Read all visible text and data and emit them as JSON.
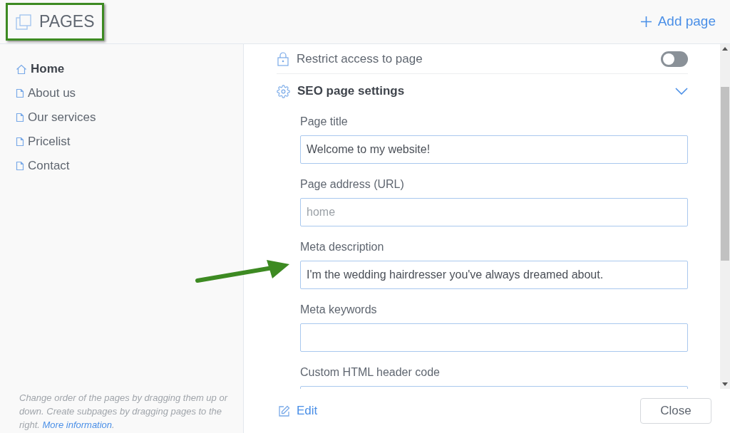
{
  "header": {
    "title": "PAGES",
    "add_button": "Add page"
  },
  "sidebar": {
    "items": [
      {
        "label": "Home",
        "kind": "home",
        "selected": true
      },
      {
        "label": "About us",
        "kind": "page",
        "selected": false
      },
      {
        "label": "Our services",
        "kind": "page",
        "selected": false
      },
      {
        "label": "Pricelist",
        "kind": "page",
        "selected": false
      },
      {
        "label": "Contact",
        "kind": "page",
        "selected": false
      }
    ],
    "hint": "Change order of the pages by dragging them up or down. Create subpages by dragging pages to the right.",
    "hint_link": "More information",
    "hint_end": "."
  },
  "settings": {
    "restrict_access": {
      "label": "Restrict access to page",
      "on": false
    },
    "seo": {
      "label": "SEO page settings",
      "expanded": true,
      "fields": [
        {
          "label": "Page title",
          "value": "Welcome to my website!"
        },
        {
          "label": "Page address (URL)",
          "placeholder": "home"
        },
        {
          "label": "Meta description",
          "value": "I'm the wedding hairdresser you've always dreamed about."
        },
        {
          "label": "Meta keywords"
        },
        {
          "label": "Custom HTML header code"
        }
      ]
    }
  },
  "footer": {
    "edit": "Edit",
    "close": "Close"
  }
}
